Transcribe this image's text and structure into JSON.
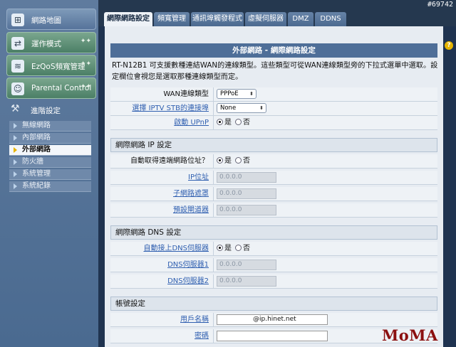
{
  "corner_id": "#69742",
  "sidebar": {
    "big_items": [
      {
        "label": "網路地圖",
        "icon": "network-map-icon"
      },
      {
        "label": "運作模式",
        "icon": "operation-mode-icon"
      },
      {
        "label": "EzQoS頻寬管理",
        "icon": "qos-icon"
      },
      {
        "label": "Parental Control",
        "icon": "parental-control-icon"
      }
    ],
    "section_label": "進階設定",
    "sub_items": [
      {
        "label": "無線網路"
      },
      {
        "label": "內部網路"
      },
      {
        "label": "外部網路"
      },
      {
        "label": "防火牆"
      },
      {
        "label": "系統管理"
      },
      {
        "label": "系統紀錄"
      }
    ]
  },
  "tabs": [
    "網際網路設定",
    "頻寬管理",
    "通訊埠觸發程式",
    "虛擬伺服器",
    "DMZ",
    "DDNS"
  ],
  "panel": {
    "title": "外部網路 - 網際網路設定",
    "intro": "RT-N12B1 可支援數種連結WAN的連線類型。這些類型可從WAN連線類型旁的下拉式選單中選取。設定欄位會視您是選取那種連線類型而定。"
  },
  "wan": {
    "type_label": "WAN連線類型",
    "type_value": "PPPoE",
    "iptv_label": "選擇 IPTV STB的連接埠",
    "iptv_value": "None",
    "upnp_label": "啟動 UPnP",
    "yes": "是",
    "no": "否"
  },
  "ip_section": {
    "title": "網際網路 IP 設定",
    "auto_label": "自動取得遠端網路位址？",
    "ip_label": "IP位址",
    "ip_value": "0.0.0.0",
    "mask_label": "子網路遮罩",
    "mask_value": "0.0.0.0",
    "gw_label": "預設閘道器",
    "gw_value": "0.0.0.0"
  },
  "dns_section": {
    "title": "網際網路 DNS 設定",
    "auto_label": "自動接上DNS伺服器",
    "dns1_label": "DNS伺服器1",
    "dns1_value": "0.0.0.0",
    "dns2_label": "DNS伺服器2",
    "dns2_value": "0.0.0.0"
  },
  "account_section": {
    "title": "帳號設定",
    "user_label": "用戶名稱",
    "user_value": "@ip.hinet.net",
    "pass_label": "密碼",
    "pass_value": ""
  },
  "watermark": "MoMA"
}
